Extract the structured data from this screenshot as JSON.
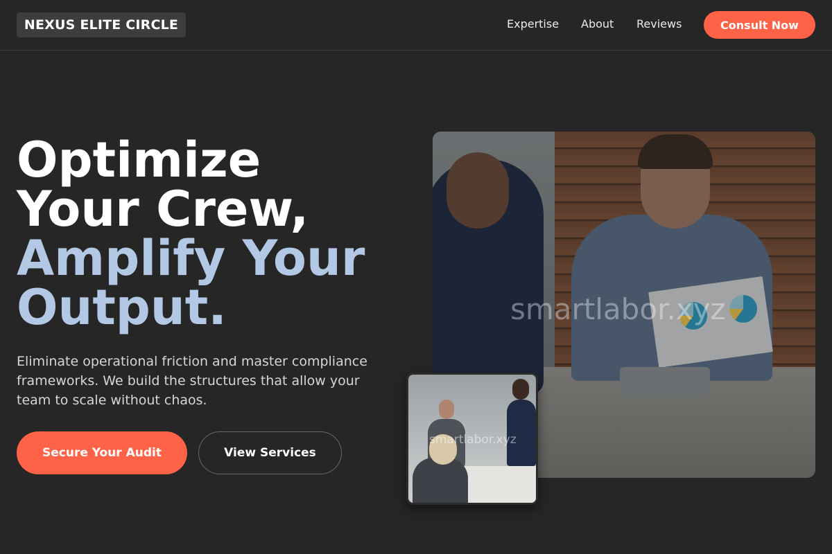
{
  "header": {
    "logo": "NEXUS ELITE CIRCLE",
    "nav": [
      "Expertise",
      "About",
      "Reviews"
    ],
    "cta": "Consult Now"
  },
  "hero": {
    "headline_line1": "Optimize",
    "headline_line2": "Your Crew,",
    "headline_line3": "Amplify Your",
    "headline_line4": "Output.",
    "subtext": "Eliminate operational friction and master compliance frameworks. We build the structures that allow your team to scale without chaos.",
    "primary_button": "Secure Your Audit",
    "secondary_button": "View Services"
  },
  "images": {
    "main_watermark": "smartlabor.xyz",
    "small_watermark": "smartlabor.xyz"
  },
  "colors": {
    "background": "#262626",
    "accent": "#ff6347",
    "headline_highlight": "#b3c8e4"
  }
}
